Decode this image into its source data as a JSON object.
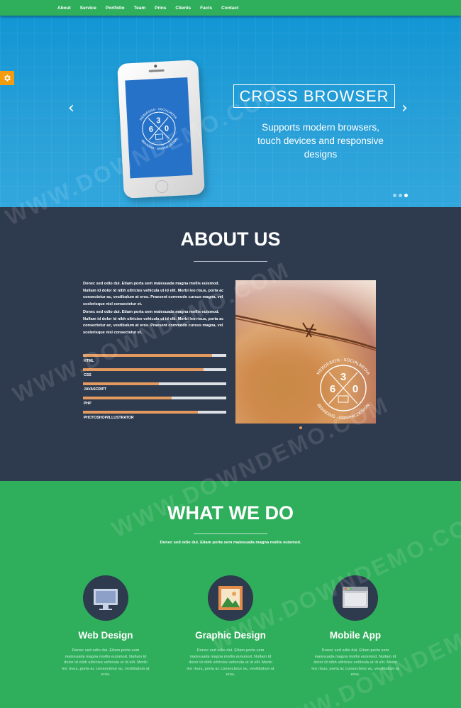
{
  "nav": {
    "items": [
      "About",
      "Service",
      "Portfolio",
      "Team",
      "Prins",
      "Clients",
      "Facts",
      "Contact"
    ]
  },
  "hero": {
    "title": "CROSS BROWSER",
    "text": "Supports modern browsers, touch devices and responsive designs",
    "phone_logo": {
      "top": "3",
      "left": "6",
      "right": "0",
      "ring_top": "WEBDESIGN · SOCIALMEDIA",
      "ring_bottom": "BRANDING · GRAPHICDESIGN"
    },
    "arrows": {
      "prev": "‹",
      "next": "›"
    },
    "slide_count": 3,
    "active_slide": 3
  },
  "about": {
    "title": "ABOUT US",
    "para1": "Donec sed odio dui. Etiam porta sem malesuada magna mollis euismod. Nullam id dolor id nibh ultricies vehicula ut id elit. Morbi leo risus, porta ac consectetur ac, vestibulum at eros. Praesent commodo cursus magna, vel scelerisque nisl consectetur et.",
    "para2": "Donec sed odio dui. Etiam porta sem malesuada magna mollis euismod. Nullam id dolor id nibh ultricies vehicula ut id elit. Morbi leo risus, porta ac consectetur ac, vestibulum at eros. Praesent commodo cursus magna, vel scelerisque nisl consectetur et.",
    "skills": [
      {
        "label": "HTML",
        "percent": 90
      },
      {
        "label": "CSS",
        "percent": 84
      },
      {
        "label": "JAVASCRIPT",
        "percent": 53
      },
      {
        "label": "PHP",
        "percent": 62
      },
      {
        "label": "PHOTOSHOP/ILLUSTRATOR",
        "percent": 80
      }
    ],
    "image_logo": {
      "top": "3",
      "left": "6",
      "right": "0",
      "ring_top": "WEBDESIGN · SOCIALMEDIA",
      "ring_bottom": "BRANDING · GRAPHICDESIGN"
    }
  },
  "services": {
    "title": "WHAT WE DO",
    "subtitle": "Donec sed odio dui. Etiam porta sem malesuada magna mollis euismod.",
    "items": [
      {
        "title": "Web Design",
        "icon": "monitor-icon",
        "text": "Donec sed odio dui. Etiam porta sem malesuada magna mollis euismod. Nullam id dolor id nibh ultricies vehicula ut id elit. Morbi leo risus, porta ac consectetur ac, vestibulum at eros."
      },
      {
        "title": "Graphic Design",
        "icon": "picture-icon",
        "text": "Donec sed odio dui. Etiam porta sem malesuada magna mollis euismod. Nullam id dolor id nibh ultricies vehicula ut id elit. Morbi leo risus, porta ac consectetur ac, vestibulum at eros."
      },
      {
        "title": "Mobile App",
        "icon": "browser-window-icon",
        "text": "Donec sed odio dui. Etiam porta sem malesuada magna mollis euismod. Nullam id dolor id nibh ultricies vehicula ut id elit. Morbi leo risus, porta ac consectetur ac, vestibulum at eros."
      }
    ]
  },
  "watermark": "WWW.DOWNDEMO.COM",
  "colors": {
    "green": "#2fae5b",
    "navy": "#2e3a4e",
    "blue": "#1296d4",
    "orange": "#f39c12",
    "bar": "#e49a5e"
  }
}
